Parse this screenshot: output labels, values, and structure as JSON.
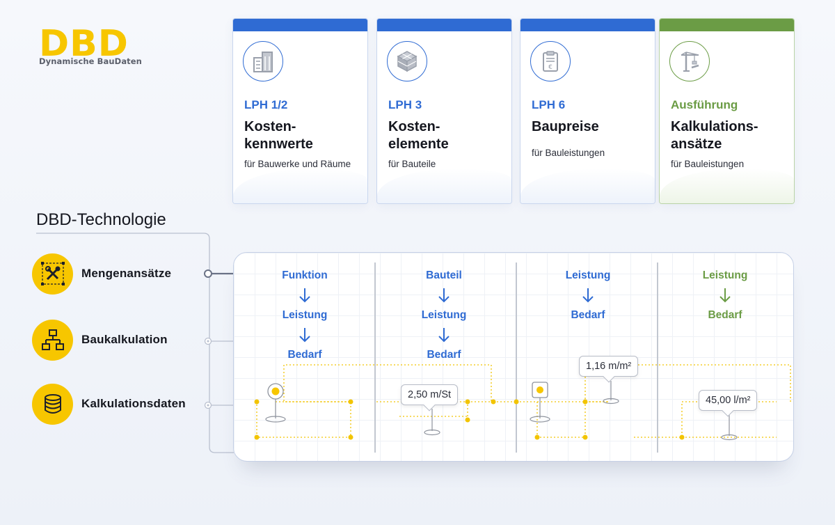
{
  "logo": {
    "mark": "DBD",
    "subtitle": "Dynamische BauDaten"
  },
  "cards": [
    {
      "phase": "LPH 1/2",
      "title_lines": [
        "Kosten-",
        "kennwerte"
      ],
      "subtitle": "für Bauwerke und Räume",
      "icon": "building-icon",
      "accent": "#2f6bd3"
    },
    {
      "phase": "LPH 3",
      "title_lines": [
        "Kosten-",
        "elemente"
      ],
      "subtitle": "für Bauteile",
      "icon": "cube-icon",
      "accent": "#2f6bd3"
    },
    {
      "phase": "LPH 6",
      "title_lines": [
        "Baupreise"
      ],
      "subtitle": "für Bauleistungen",
      "icon": "price-clipboard-icon",
      "accent": "#2f6bd3"
    },
    {
      "phase": "Ausführung",
      "title_lines": [
        "Kalkulations-",
        "ansätze"
      ],
      "subtitle": "für Bauleistungen",
      "icon": "crane-icon",
      "accent": "#6b9c45"
    }
  ],
  "technology": {
    "heading": "DBD-Technologie",
    "items": [
      {
        "label": "Mengenansätze",
        "icon": "tools-icon"
      },
      {
        "label": "Baukalkulation",
        "icon": "hierarchy-icon"
      },
      {
        "label": "Kalkulationsdaten",
        "icon": "database-icon"
      }
    ]
  },
  "flow": {
    "columns": [
      {
        "steps": [
          "Funktion",
          "Leistung",
          "Bedarf"
        ]
      },
      {
        "steps": [
          "Bauteil",
          "Leistung",
          "Bedarf"
        ]
      },
      {
        "steps": [
          "Leistung",
          "Bedarf"
        ]
      },
      {
        "steps": [
          "Leistung",
          "Bedarf"
        ]
      }
    ],
    "tags": [
      "2,50 m/St",
      "1,16 m/m²",
      "45,00 l/m²"
    ]
  },
  "colors": {
    "blue": "#2f6bd3",
    "green": "#6b9c45",
    "yellow": "#f7c600"
  }
}
